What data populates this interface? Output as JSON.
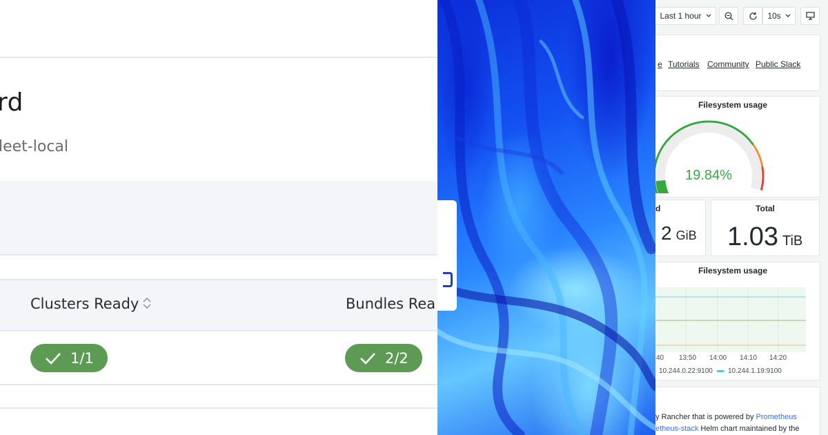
{
  "fleet": {
    "title": "rd",
    "subtitle": "leet-local",
    "columns": [
      {
        "label": "Clusters Ready"
      },
      {
        "label": "Bundles Rea"
      }
    ],
    "badges": [
      {
        "value": "1/1"
      },
      {
        "value": "2/2"
      }
    ],
    "colors": {
      "badge": "#5d9b54",
      "band": "#f3f5f9"
    }
  },
  "grafana": {
    "toolbar": {
      "time_range": "Last 1 hour",
      "refresh_interval": "10s"
    },
    "links": [
      "e",
      "Tutorials",
      "Community",
      "Public Slack"
    ],
    "gauge": {
      "title": "Filesystem usage",
      "value_text": "19.84%",
      "value": 19.84,
      "color": "#37a643"
    },
    "stats": [
      {
        "title": "d",
        "value": "2",
        "unit": "GiB"
      },
      {
        "title": "Total",
        "value": "1.03",
        "unit": "TiB"
      }
    ],
    "timeseries": {
      "title": "Filesystem usage",
      "x_ticks": [
        "40",
        "13:50",
        "14:00",
        "14:10",
        "14:20"
      ],
      "legend": [
        "10.244.0.22:9100",
        "10.244.1.19:9100"
      ]
    },
    "footer": {
      "line1_prefix": "y Rancher that is powered by ",
      "line1_link": "Prometheus",
      "line2_link": "etheus-stack",
      "line2_suffix": " Helm chart maintained by the"
    }
  }
}
